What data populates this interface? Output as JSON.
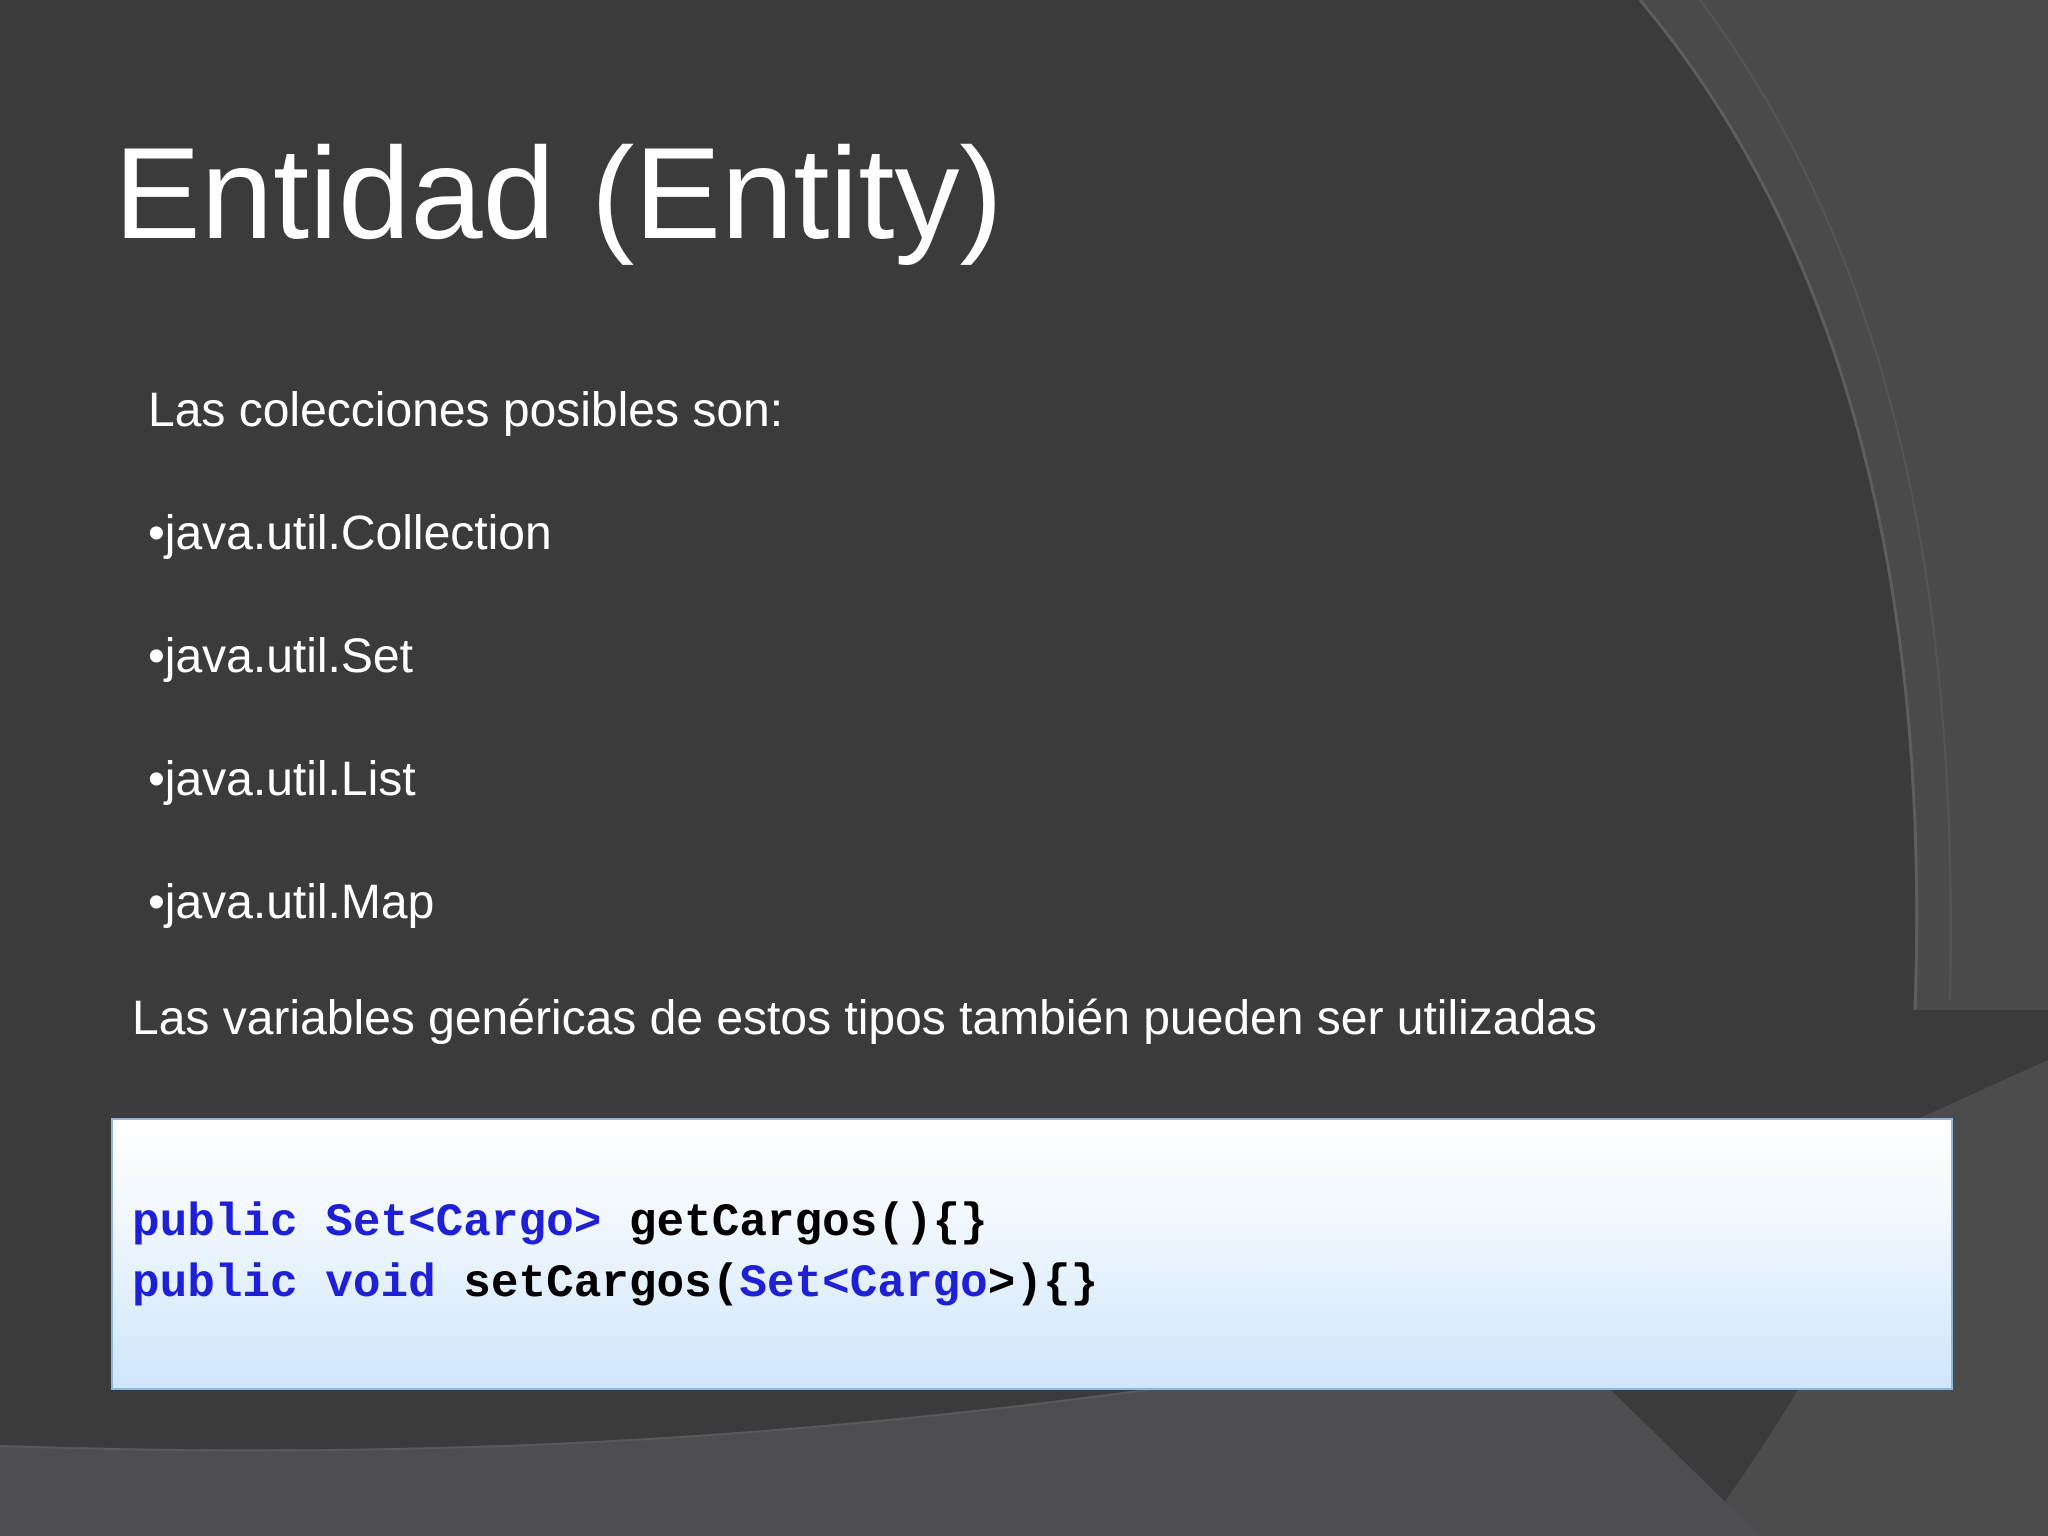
{
  "slide": {
    "title": "Entidad (Entity)",
    "intro": "Las colecciones posibles son:",
    "bullets": [
      "•java.util.Collection",
      "•java.util.Set",
      "•java.util.List",
      "•java.util.Map"
    ],
    "note": "Las variables genéricas de estos tipos también pueden ser utilizadas"
  },
  "code": {
    "line1": {
      "kw_public": "public",
      "type": "Set<Cargo>",
      "rest": "getCargos(){}"
    },
    "line2": {
      "kw_public": "public",
      "kw_void": "void",
      "method": "setCargos(",
      "param_type": "Set<Cargo",
      "tail": ">){}"
    }
  },
  "colors": {
    "background": "#3b3b3c",
    "text": "#ffffff",
    "code_keyword": "#1f1fd6",
    "code_text": "#000000",
    "code_box_border": "#8eb7e0"
  }
}
